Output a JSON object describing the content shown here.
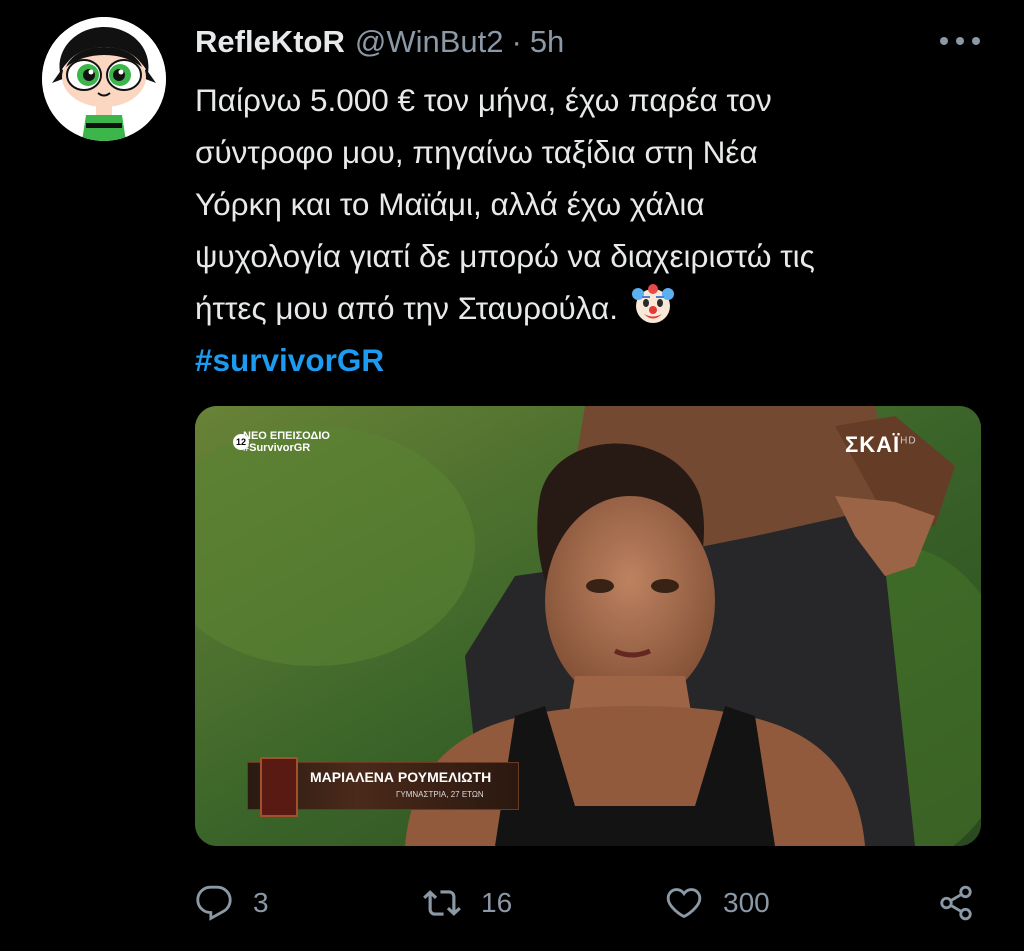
{
  "tweet": {
    "author": {
      "display_name": "RefleKtoR",
      "handle": "@WinBut2",
      "separator": "·",
      "timestamp": "5h"
    },
    "text_lines": [
      "Παίρνω 5.000 € τον μήνα, έχω παρέα τον",
      "σύντροφο μου, πηγαίνω ταξίδια στη Νέα",
      "Υόρκη και το Μαϊάμι, αλλά έχω χάλια",
      "ψυχολογία γιατί δε μπορώ να διαχειριστώ τις",
      "ήττες μου από την Σταυρούλα."
    ],
    "emoji": "clown-face-emoji",
    "hashtag": "#survivorGR",
    "media": {
      "overlay_top_left_line1": "ΝΕΟ ΕΠΕΙΣΟΔΙΟ",
      "overlay_top_left_line2": "#SurvivorGR",
      "overlay_badge": "12",
      "channel_logo": "ΣΚΑΪ",
      "channel_logo_hd": "HD",
      "lower_third_name": "ΜΑΡΙΑΛΕΝΑ ΡΟΥΜΕΛΙΩΤΗ",
      "lower_third_sub": "ΓΥΜΝΑΣΤΡΙΑ, 27 ΕΤΩΝ"
    },
    "actions": {
      "replies": "3",
      "retweets": "16",
      "likes": "300"
    }
  },
  "colors": {
    "background": "#000000",
    "text": "#e7e9ea",
    "secondary": "#8b98a5",
    "link": "#1d9bf0"
  }
}
